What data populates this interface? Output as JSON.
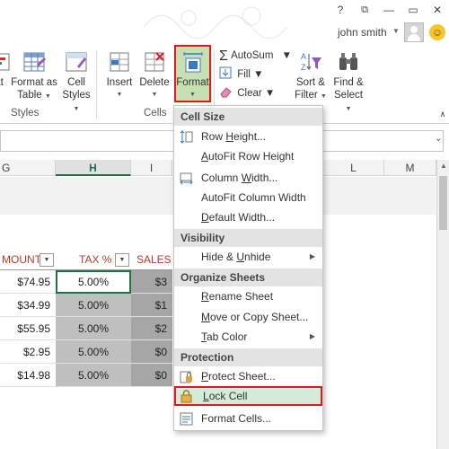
{
  "window": {
    "help_btn": "?",
    "restore_btn": "⧉",
    "minimize_btn": "—",
    "maximize_btn": "▭",
    "close_btn": "✕"
  },
  "account": {
    "user_name": "john smith"
  },
  "ribbon": {
    "styles": {
      "partial_label": "at",
      "format_as_table": [
        "Format as",
        "Table"
      ],
      "cell_styles": [
        "Cell",
        "Styles"
      ],
      "group_label": "Styles"
    },
    "cells": {
      "insert": "Insert",
      "delete": "Delete",
      "format": "Format",
      "group_label": "Cells"
    },
    "editing": {
      "autosum": "AutoSum",
      "fill": "Fill",
      "clear": "Clear",
      "sort_filter": [
        "Sort &",
        "Filter"
      ],
      "find_select": [
        "Find &",
        "Select"
      ]
    }
  },
  "sheet": {
    "columns": [
      "G",
      "H",
      "I",
      "L",
      "M"
    ],
    "selected_column": "H",
    "table_headers": [
      "MOUNT",
      "TAX %",
      "SALES T"
    ],
    "rows": [
      {
        "amount": "$74.95",
        "tax": "5.00%",
        "sales": "$3"
      },
      {
        "amount": "$34.99",
        "tax": "5.00%",
        "sales": "$1"
      },
      {
        "amount": "$55.95",
        "tax": "5.00%",
        "sales": "$2"
      },
      {
        "amount": "$2.95",
        "tax": "5.00%",
        "sales": "$0"
      },
      {
        "amount": "$14.98",
        "tax": "5.00%",
        "sales": "$0"
      }
    ]
  },
  "menu": {
    "sections": [
      "Cell Size",
      "Visibility",
      "Organize Sheets",
      "Protection"
    ],
    "items": [
      {
        "label": "Row Height...",
        "u": "H"
      },
      {
        "label": "AutoFit Row Height",
        "u": "A"
      },
      {
        "label": "Column Width...",
        "u": "W"
      },
      {
        "label": "AutoFit Column Width",
        "u": "I"
      },
      {
        "label": "Default Width...",
        "u": "D"
      },
      {
        "label": "Hide & Unhide",
        "u": "U"
      },
      {
        "label": "Rename Sheet",
        "u": "R"
      },
      {
        "label": "Move or Copy Sheet...",
        "u": "M"
      },
      {
        "label": "Tab Color",
        "u": "T"
      },
      {
        "label": "Protect Sheet...",
        "u": "P"
      },
      {
        "label": "Lock Cell",
        "u": "L"
      },
      {
        "label": "Format Cells...",
        "u": "E"
      }
    ],
    "highlighted": "Lock Cell"
  },
  "colors": {
    "excel_green": "#217346",
    "highlight_red": "#e0191a",
    "menu_highlight": "#d3ecd9"
  }
}
